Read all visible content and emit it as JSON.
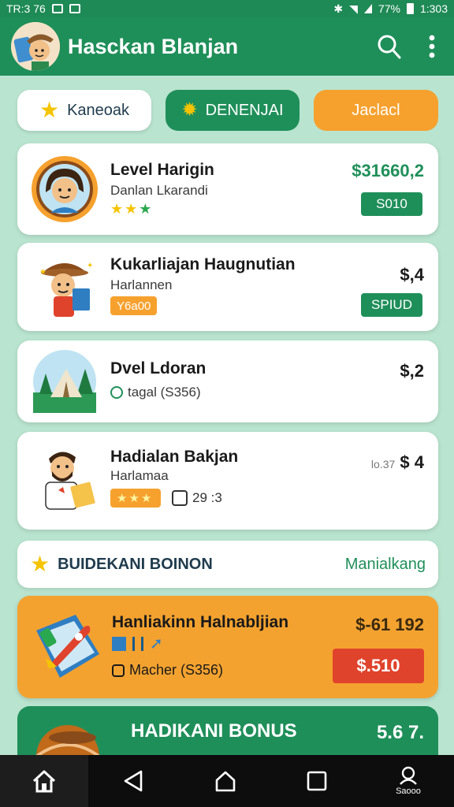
{
  "status_bar": {
    "left_text": "TR:3 76",
    "right_text": "1:303",
    "battery_text": "77%"
  },
  "app": {
    "title": "Hasckan Blanjan"
  },
  "tabs": [
    {
      "label": "Kaneoak",
      "icon": "star-icon"
    },
    {
      "label": "DENENJAI",
      "icon": "gear-icon"
    },
    {
      "label": "Jaclacl",
      "icon": ""
    }
  ],
  "cards": [
    {
      "title": "Level Harigin",
      "subtitle": "Danlan Lkarandi",
      "price": "$31660,2",
      "button": "S010",
      "icon": "avatar-girl-icon"
    },
    {
      "title": "Kukarliajan Haugnutian",
      "subtitle": "Harlannen",
      "chip": "Y6a00",
      "price": "$,4",
      "button": "SPIUD",
      "icon": "explorer-icon"
    },
    {
      "title": "Dvel Ldoran",
      "subtitle": "tagal (S356)",
      "price": "$,2",
      "icon": "tent-icon"
    },
    {
      "title": "Hadialan Bakjan",
      "subtitle": "Harlamaa",
      "meta": "29  :3",
      "price_prefix": "lo.37",
      "price": "$ 4",
      "icon": "reader-icon"
    }
  ],
  "bonus_row": {
    "label": "BUIDEKANI BOINON",
    "link": "Manialkang"
  },
  "orange_card": {
    "title": "Hanliakinn Halnabljian",
    "price": "$-61 192",
    "subtitle": "Macher (S356)",
    "button": "$.510",
    "icon": "rocket-icon"
  },
  "green_card": {
    "title": "HADIKANI BONUS",
    "price": "5.6 7."
  },
  "nav": {
    "profile_label": "Saooo"
  },
  "colors": {
    "primary": "#1f8f5a",
    "accent": "#f6a12e",
    "danger": "#e0432b",
    "background": "#b9e4cf"
  }
}
